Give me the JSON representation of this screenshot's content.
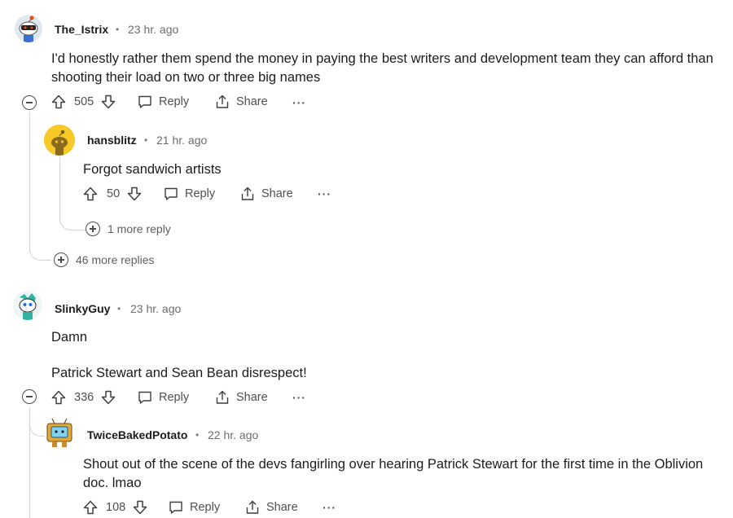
{
  "comments": [
    {
      "username": "The_Istrix",
      "time": "23 hr. ago",
      "body_lines": [
        "I'd honestly rather them spend the money in paying the best writers and development team they can afford than",
        "shooting their load on two or three big names"
      ],
      "votes": "505",
      "reply_label": "Reply",
      "share_label": "Share",
      "replies": [
        {
          "username": "hansblitz",
          "time": "21 hr. ago",
          "body": "Forgot sandwich artists",
          "votes": "50",
          "reply_label": "Reply",
          "share_label": "Share",
          "more_replies": "1 more reply"
        }
      ],
      "more_replies": "46 more replies"
    },
    {
      "username": "SlinkyGuy",
      "time": "23 hr. ago",
      "body_lines": [
        "Damn",
        "Patrick Stewart and Sean Bean disrespect!"
      ],
      "votes": "336",
      "reply_label": "Reply",
      "share_label": "Share",
      "replies": [
        {
          "username": "TwiceBakedPotato",
          "time": "22 hr. ago",
          "body_lines": [
            "Shout out of the scene of the devs fangirling over hearing Patrick Stewart for the first time in the Oblivion",
            "doc. lmao"
          ],
          "votes": "108",
          "reply_label": "Reply",
          "share_label": "Share"
        }
      ]
    }
  ],
  "separator": "•",
  "overflow_label": "···",
  "colors": {
    "accent": "#ff4500",
    "text": "#1c1c1c",
    "muted": "#6a6d70",
    "thread": "#d0d3d6"
  },
  "icons": [
    "upvote-icon",
    "downvote-icon",
    "comment-icon",
    "share-icon",
    "collapse-icon",
    "expand-icon",
    "more-options-icon"
  ]
}
